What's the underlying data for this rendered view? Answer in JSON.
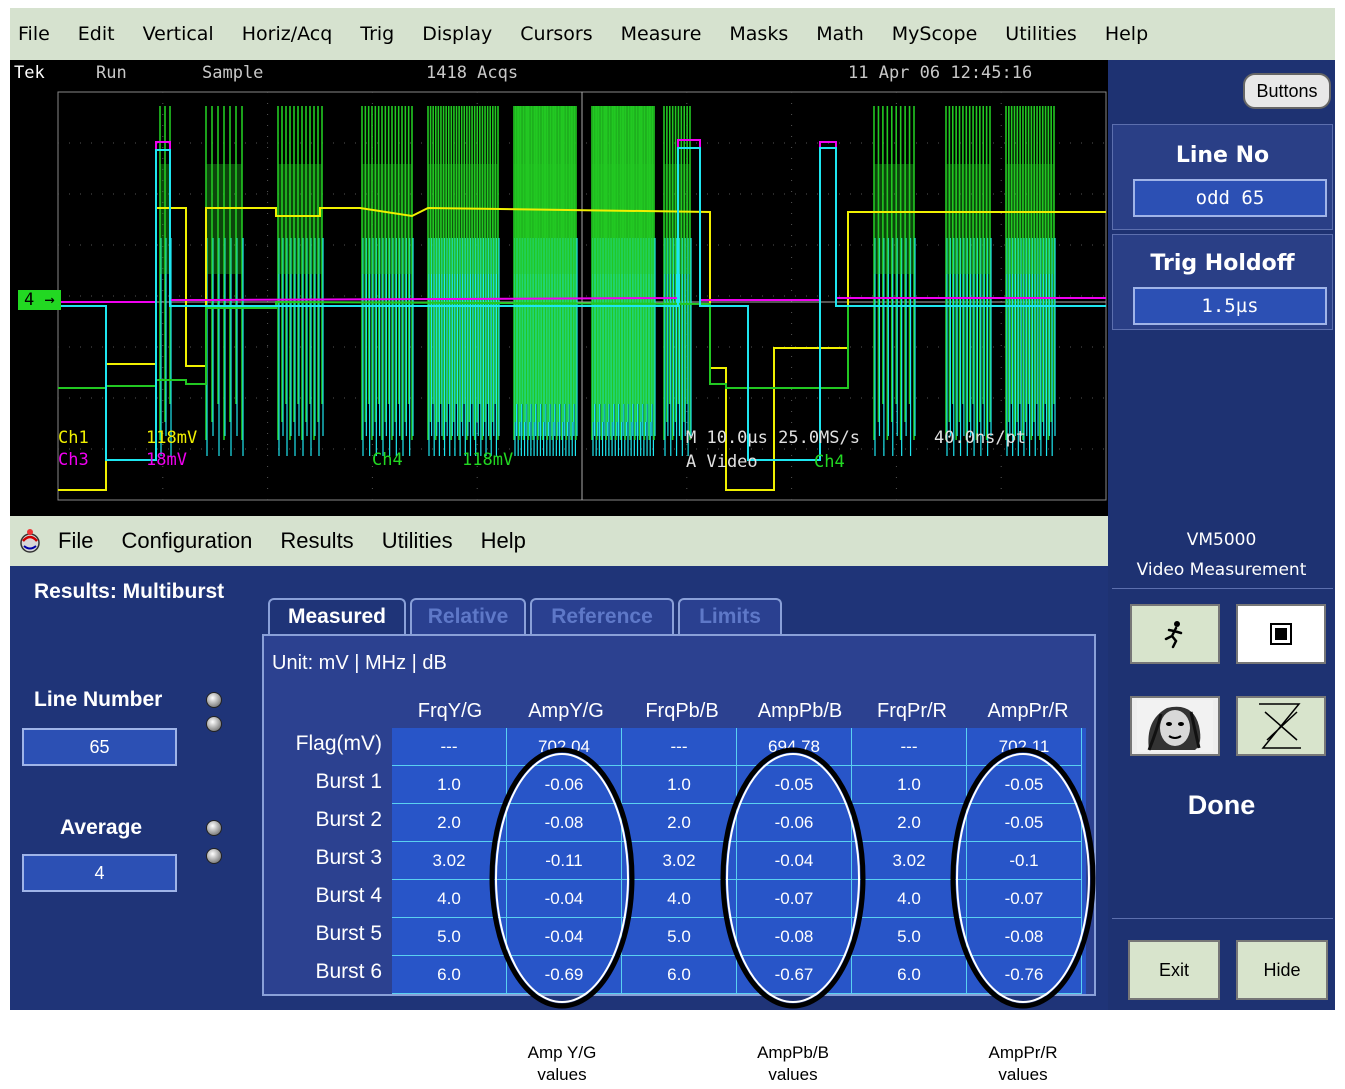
{
  "menubar": {
    "items": [
      "File",
      "Edit",
      "Vertical",
      "Horiz/Acq",
      "Trig",
      "Display",
      "Cursors",
      "Measure",
      "Masks",
      "Math",
      "MyScope",
      "Utilities",
      "Help"
    ]
  },
  "status": {
    "brand": "Tek",
    "state": "Run",
    "mode": "Sample",
    "acqs": "1418 Acqs",
    "datetime": "11 Apr 06 12:45:16"
  },
  "scope": {
    "ch1_label": "Ch1",
    "ch1_scale": "118mV",
    "ch3_label": "Ch3",
    "ch3_scale": "18mV",
    "ch4_label": "Ch4",
    "ch4_scale": "118mV",
    "timebase": "M 10.0µs 25.0MS/s",
    "resolution": "40.0ns/pt",
    "trigger": "A Video",
    "trigger_src": "Ch4",
    "marker": "4"
  },
  "right_panel": {
    "buttons_label": "Buttons",
    "line_no_title": "Line No",
    "line_no_value": "odd 65",
    "trig_holdoff_title": "Trig Holdoff",
    "trig_holdoff_value": "1.5µs"
  },
  "app_menu": {
    "items": [
      "File",
      "Configuration",
      "Results",
      "Utilities",
      "Help"
    ]
  },
  "results": {
    "title": "Results: Multiburst",
    "tabs": [
      "Measured",
      "Relative",
      "Reference",
      "Limits"
    ],
    "unit": "Unit: mV | MHz | dB",
    "columns": [
      "FrqY/G",
      "AmpY/G",
      "FrqPb/B",
      "AmpPb/B",
      "FrqPr/R",
      "AmpPr/R"
    ],
    "rows": [
      {
        "label": "Flag(mV)",
        "values": [
          "---",
          "702.04",
          "---",
          "694.78",
          "---",
          "702.11"
        ]
      },
      {
        "label": "Burst 1",
        "values": [
          "1.0",
          "-0.06",
          "1.0",
          "-0.05",
          "1.0",
          "-0.05"
        ]
      },
      {
        "label": "Burst 2",
        "values": [
          "2.0",
          "-0.08",
          "2.0",
          "-0.06",
          "2.0",
          "-0.05"
        ]
      },
      {
        "label": "Burst 3",
        "values": [
          "3.02",
          "-0.11",
          "3.02",
          "-0.04",
          "3.02",
          "-0.1"
        ]
      },
      {
        "label": "Burst 4",
        "values": [
          "4.0",
          "-0.04",
          "4.0",
          "-0.07",
          "4.0",
          "-0.07"
        ]
      },
      {
        "label": "Burst 5",
        "values": [
          "5.0",
          "-0.04",
          "5.0",
          "-0.08",
          "5.0",
          "-0.08"
        ]
      },
      {
        "label": "Burst 6",
        "values": [
          "6.0",
          "-0.69",
          "6.0",
          "-0.67",
          "6.0",
          "-0.76"
        ]
      }
    ]
  },
  "controls": {
    "line_number_label": "Line Number",
    "line_number_value": "65",
    "average_label": "Average",
    "average_value": "4"
  },
  "vm_panel": {
    "title": "VM5000",
    "subtitle": "Video Measurement",
    "status": "Done",
    "exit_label": "Exit",
    "hide_label": "Hide"
  },
  "annotations": [
    {
      "line1": "Amp Y/G",
      "line2": "values"
    },
    {
      "line1": "AmpPb/B",
      "line2": "values"
    },
    {
      "line1": "AmpPr/R",
      "line2": "values"
    }
  ],
  "colors": {
    "panel_blue": "#1f3478",
    "cell_blue": "#2855c8",
    "menu_green": "#d6e2cf",
    "trace_green": "#22c822",
    "trace_cyan": "#1ee6f0",
    "trace_yellow": "#f0f000",
    "trace_magenta": "#f000f0"
  }
}
